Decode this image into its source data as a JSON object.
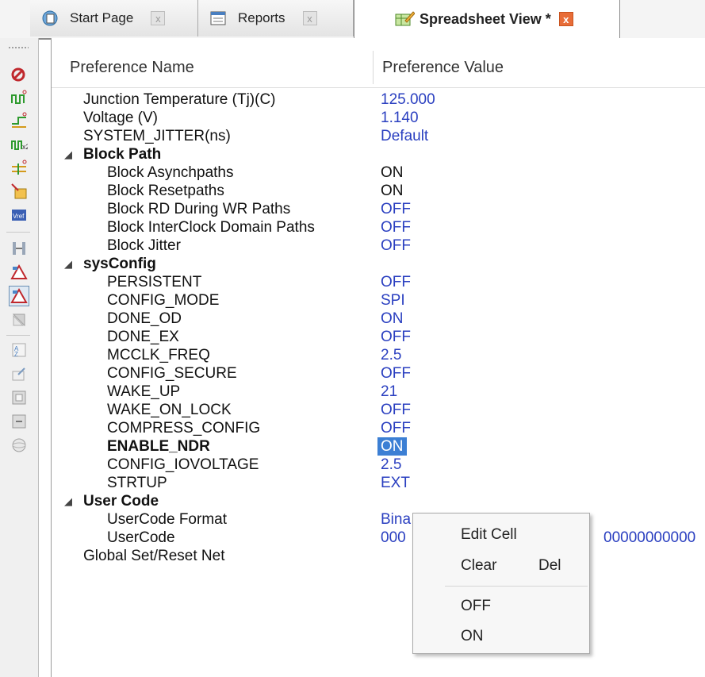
{
  "tabs": [
    {
      "label": "Start Page",
      "icon": "start-page-icon",
      "close": "x",
      "active": false
    },
    {
      "label": "Reports",
      "icon": "reports-icon",
      "close": "x",
      "active": false
    },
    {
      "label": "Spreadsheet View *",
      "icon": "spreadsheet-icon",
      "close": "x",
      "active": true
    }
  ],
  "columns": {
    "name": "Preference Name",
    "value": "Preference Value"
  },
  "rows": {
    "junction_temp": {
      "name": "Junction Temperature (Tj)(C)",
      "value": "125.000"
    },
    "voltage": {
      "name": "Voltage (V)",
      "value": "1.140"
    },
    "system_jitter": {
      "name": "SYSTEM_JITTER(ns)",
      "value": "Default"
    },
    "block_path": {
      "name": "Block Path"
    },
    "block_async": {
      "name": "Block Asynchpaths",
      "value": "ON"
    },
    "block_reset": {
      "name": "Block Resetpaths",
      "value": "ON"
    },
    "block_rd": {
      "name": "Block RD During WR Paths",
      "value": "OFF"
    },
    "block_interclock": {
      "name": "Block InterClock Domain Paths",
      "value": "OFF"
    },
    "block_jitter": {
      "name": "Block Jitter",
      "value": "OFF"
    },
    "sysconfig": {
      "name": "sysConfig"
    },
    "persistent": {
      "name": "PERSISTENT",
      "value": "OFF"
    },
    "config_mode": {
      "name": "CONFIG_MODE",
      "value": "SPI"
    },
    "done_od": {
      "name": "DONE_OD",
      "value": "ON"
    },
    "done_ex": {
      "name": "DONE_EX",
      "value": "OFF"
    },
    "mcclk_freq": {
      "name": "MCCLK_FREQ",
      "value": "2.5"
    },
    "config_secure": {
      "name": "CONFIG_SECURE",
      "value": "OFF"
    },
    "wake_up": {
      "name": "WAKE_UP",
      "value": "21"
    },
    "wake_on_lock": {
      "name": "WAKE_ON_LOCK",
      "value": "OFF"
    },
    "compress_config": {
      "name": "COMPRESS_CONFIG",
      "value": "OFF"
    },
    "enable_ndr": {
      "name": "ENABLE_NDR",
      "value": "ON"
    },
    "config_iovoltage": {
      "name": "CONFIG_IOVOLTAGE",
      "value": "2.5"
    },
    "strtup": {
      "name": "STRTUP",
      "value": "EXT"
    },
    "user_code_group": {
      "name": "User Code"
    },
    "usercode_format": {
      "name": "UserCode Format",
      "value": "Bina"
    },
    "usercode": {
      "name": "UserCode",
      "value": "000",
      "value_tail": "00000000000"
    },
    "gsr_net": {
      "name": "Global Set/Reset Net"
    }
  },
  "context_menu": {
    "edit_cell": "Edit Cell",
    "clear": "Clear",
    "clear_shortcut": "Del",
    "off": "OFF",
    "on": "ON"
  },
  "colors": {
    "value_blue": "#2a3fc0",
    "selection": "#3c7fd4",
    "active_tab_close": "#e86d38"
  },
  "toolbar_icons": [
    "timing-check-icon",
    "clock-icon",
    "io-timing-icon",
    "clock-jitter-icon",
    "path-icon",
    "import-icon",
    "vref-icon",
    "group-icon",
    "warning-icon",
    "warning-active-icon",
    "disabled-icon",
    "sort-icon",
    "export-icon",
    "expand-icon",
    "collapse-icon",
    "globe-icon"
  ]
}
